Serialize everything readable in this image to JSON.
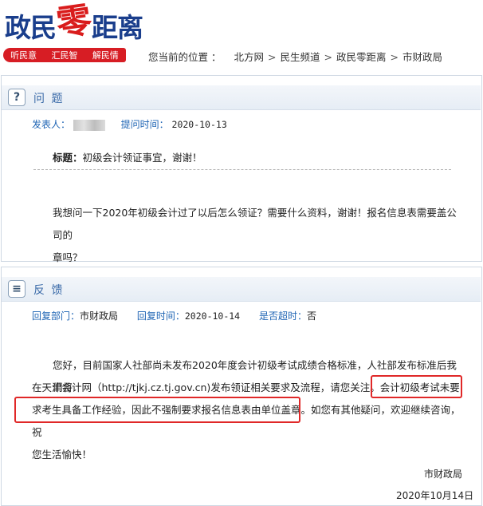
{
  "header": {
    "logo_prefix": "政民",
    "logo_highlight": "零",
    "logo_suffix": "距离",
    "slogans": [
      "听民意",
      "汇民智",
      "解民情"
    ],
    "breadcrumb_label": "您当前的位置 ：",
    "breadcrumb": [
      "北方网",
      "民生频道",
      "政民零距离",
      "市财政局"
    ]
  },
  "question": {
    "section_title": "问 题",
    "icon_glyph": "?",
    "author_label": "发表人：",
    "time_label": "提问时间：",
    "time_value": "2020-10-13",
    "topic_label": "标题：",
    "topic_value": "初级会计领证事宜，谢谢！",
    "body_line1": "我想问一下2020年初级会计过了以后怎么领证？需要什么资料，谢谢！报名信息表需要盖公司的",
    "body_line2": "章吗？"
  },
  "reply": {
    "section_title": "反 馈",
    "dept_label": "回复部门：",
    "dept_value": "市财政局",
    "time_label": "回复时间：",
    "time_value": "2020-10-14",
    "overdue_label": "是否超时：",
    "overdue_value": "否",
    "line1": "您好，目前国家人社部尚未发布2020年度会计初级考试成绩合格标准，人社部发布标准后我们将",
    "line2": "在天津会计网（http://tjkj.cz.tj.gov.cn)发布领证相关要求及流程，请您关注。会计初级考试未要",
    "line3": "求考生具备工作经验，因此不强制要求报名信息表由单位盖章。如您有其他疑问，欢迎继续咨询，祝",
    "line4": "您生活愉快！",
    "signature": "市财政局",
    "date": "2020年10月14日"
  },
  "colors": {
    "brand_blue": "#1a3e8c",
    "brand_red": "#d71d24",
    "label_blue": "#1e64b4",
    "highlight_red": "#e02828"
  }
}
